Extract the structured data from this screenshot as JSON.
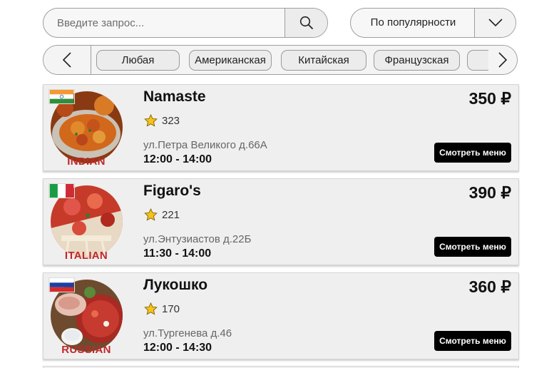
{
  "search": {
    "placeholder": "Введите запрос...",
    "icon": "search-icon"
  },
  "sort": {
    "value": "По популярности",
    "icon": "chevron-down-icon"
  },
  "categories": {
    "prev_icon": "chevron-left-icon",
    "next_icon": "chevron-right-icon",
    "items": [
      "Любая",
      "Американская",
      "Китайская",
      "Французская"
    ]
  },
  "restaurants": [
    {
      "name": "Namaste",
      "rating": "323",
      "address": "ул.Петра Великого д.66А",
      "hours": "12:00 - 14:00",
      "price": "350 ₽",
      "cuisine": "INDIAN",
      "menu_button": "Смотреть меню",
      "flag": "india-flag",
      "accent": "#d0651f"
    },
    {
      "name": "Figaro's",
      "rating": "221",
      "address": "ул.Энтузиастов д.22Б",
      "hours": "11:30 - 14:00",
      "price": "390 ₽",
      "cuisine": "ITALIAN",
      "menu_button": "Смотреть меню",
      "flag": "italy-flag",
      "accent": "#d8402c"
    },
    {
      "name": "Лукошко",
      "rating": "170",
      "address": "ул.Тургенева д.46",
      "hours": "12:00 - 14:30",
      "price": "360 ₽",
      "cuisine": "RUSSIAN",
      "menu_button": "Смотреть меню",
      "flag": "russia-flag",
      "accent": "#b8282d"
    }
  ],
  "colors": {
    "cuisine_label": "#c0282b",
    "star": "#f5c21b",
    "button_bg": "#000000"
  }
}
